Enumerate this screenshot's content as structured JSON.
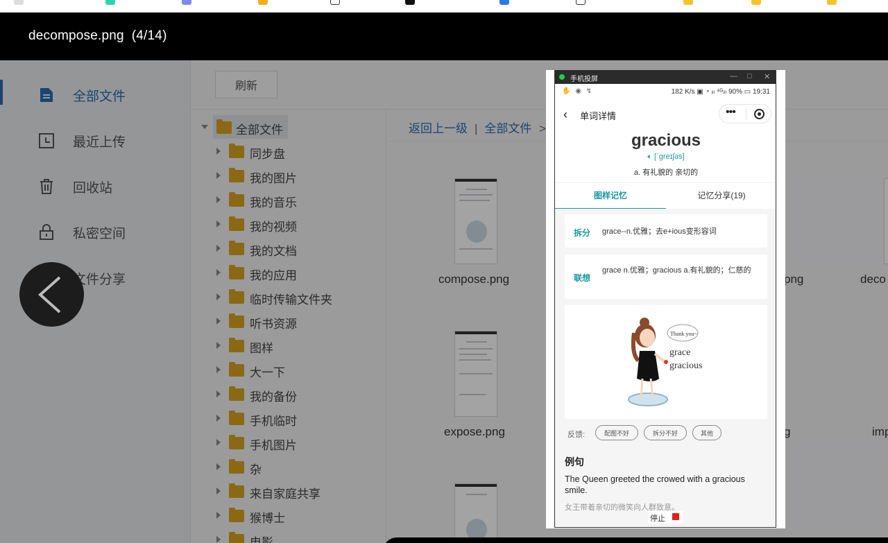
{
  "viewer": {
    "title": "decompose.png  (4/14)"
  },
  "sidebar": {
    "items": [
      {
        "label": "全部文件",
        "icon": "file-icon",
        "active": true
      },
      {
        "label": "最近上传",
        "icon": "clock-icon"
      },
      {
        "label": "回收站",
        "icon": "trash-icon"
      },
      {
        "label": "私密空间",
        "icon": "lock-icon"
      },
      {
        "label": "文件分享",
        "icon": "share-icon"
      }
    ]
  },
  "toolbar": {
    "refresh_label": "刷新"
  },
  "tree": {
    "root": "全部文件",
    "folders": [
      "同步盘",
      "我的图片",
      "我的音乐",
      "我的视频",
      "我的文档",
      "我的应用",
      "临时传输文件夹",
      "听书资源",
      "图样",
      "大一下",
      "我的备份",
      "手机临时",
      "手机图片",
      "杂",
      "来自家庭共享",
      "猴博士",
      "电影"
    ]
  },
  "breadcrumb": {
    "back": "返回上一级",
    "sep": "|",
    "root": "全部文件",
    "arrow": ">"
  },
  "files": {
    "row1": [
      "compose.png",
      "png",
      "deco"
    ],
    "row2": [
      "expose.png",
      "g",
      "imp"
    ]
  },
  "phone": {
    "window_title": "手机投屏",
    "window_controls": [
      "—",
      "□",
      "✕"
    ],
    "status_left": "✋ ◉ ↯",
    "status_right": "182 K/s ▣ ◔ ᵢₗₗ ⁴ᴳᵢₗₗ 90% ▭ 19:31",
    "nav_title": "单词详情",
    "word": "gracious",
    "phonetic": "[ˈɡreɪʃəs]",
    "meaning": "a. 有礼貌的 亲切的",
    "tabs": [
      "图样记忆",
      "记忆分享(19)"
    ],
    "cards": [
      {
        "key": "拆分",
        "value": "grace--n.优雅；去e+ious变形容词"
      },
      {
        "key": "联想",
        "value": "grace n.优雅；gracious a.有礼貌的；仁慈的"
      }
    ],
    "illustration": {
      "speech": "Thank you~",
      "line1": "grace",
      "line2": "gracious"
    },
    "feedback": {
      "label": "反馈:",
      "buttons": [
        "配图不好",
        "拆分不好",
        "其他"
      ]
    },
    "example": {
      "title": "例句",
      "en": "The Queen greeted the crowed with a gracious smile.",
      "cn": "女王带着亲切的微笑向人群致意。"
    },
    "stop_label": "停止"
  },
  "colors": {
    "accent": "#1a9aa0",
    "link": "#2b6cb0",
    "folder": "#d9a520",
    "stop": "#e0201c"
  }
}
